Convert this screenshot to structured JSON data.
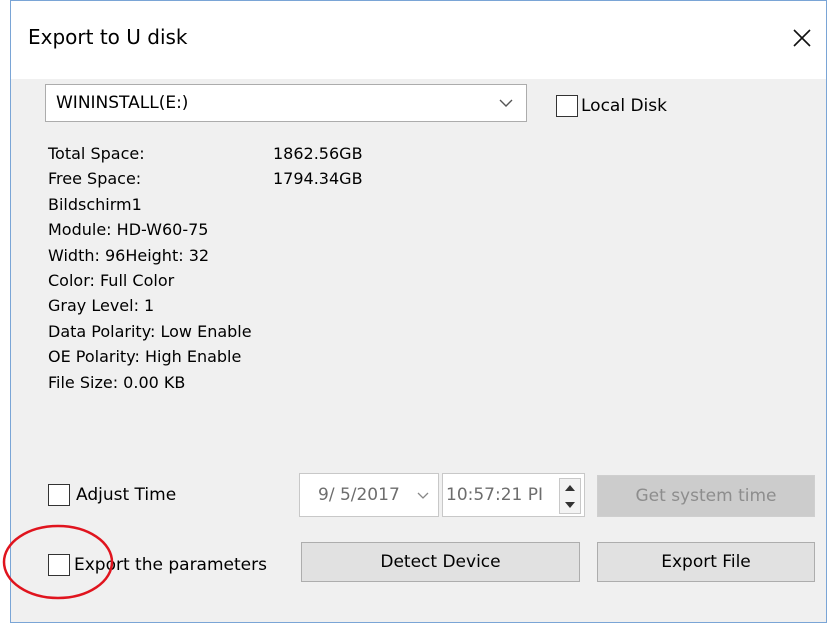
{
  "window": {
    "title": "Export to U disk"
  },
  "drive": {
    "selected": "WININSTALL(E:)",
    "local_disk_label": "Local Disk"
  },
  "info": {
    "rows": [
      {
        "label": "Total Space:",
        "value": "1862.56GB"
      },
      {
        "label": "Free Space:",
        "value": "1794.34GB"
      },
      {
        "label": "Bildschirm1",
        "value": ""
      },
      {
        "label": "Module: HD-W60-75",
        "value": ""
      },
      {
        "label": "Width: 96Height: 32",
        "value": ""
      },
      {
        "label": "Color: Full Color",
        "value": ""
      },
      {
        "label": "Gray Level: 1",
        "value": ""
      },
      {
        "label": "Data Polarity: Low Enable",
        "value": ""
      },
      {
        "label": "OE Polarity: High Enable",
        "value": ""
      },
      {
        "label": "File Size: 0.00 KB",
        "value": ""
      }
    ]
  },
  "time": {
    "adjust_label": "Adjust Time",
    "date_value": "9/ 5/2017",
    "time_value": "10:57:21 PI",
    "get_system_time_label": "Get system time"
  },
  "footer": {
    "export_params_label": "Export the parameters",
    "detect_device_label": "Detect Device",
    "export_file_label": "Export File"
  },
  "colors": {
    "annotation_circle": "#e0141e",
    "window_border": "#7aa5d6"
  }
}
